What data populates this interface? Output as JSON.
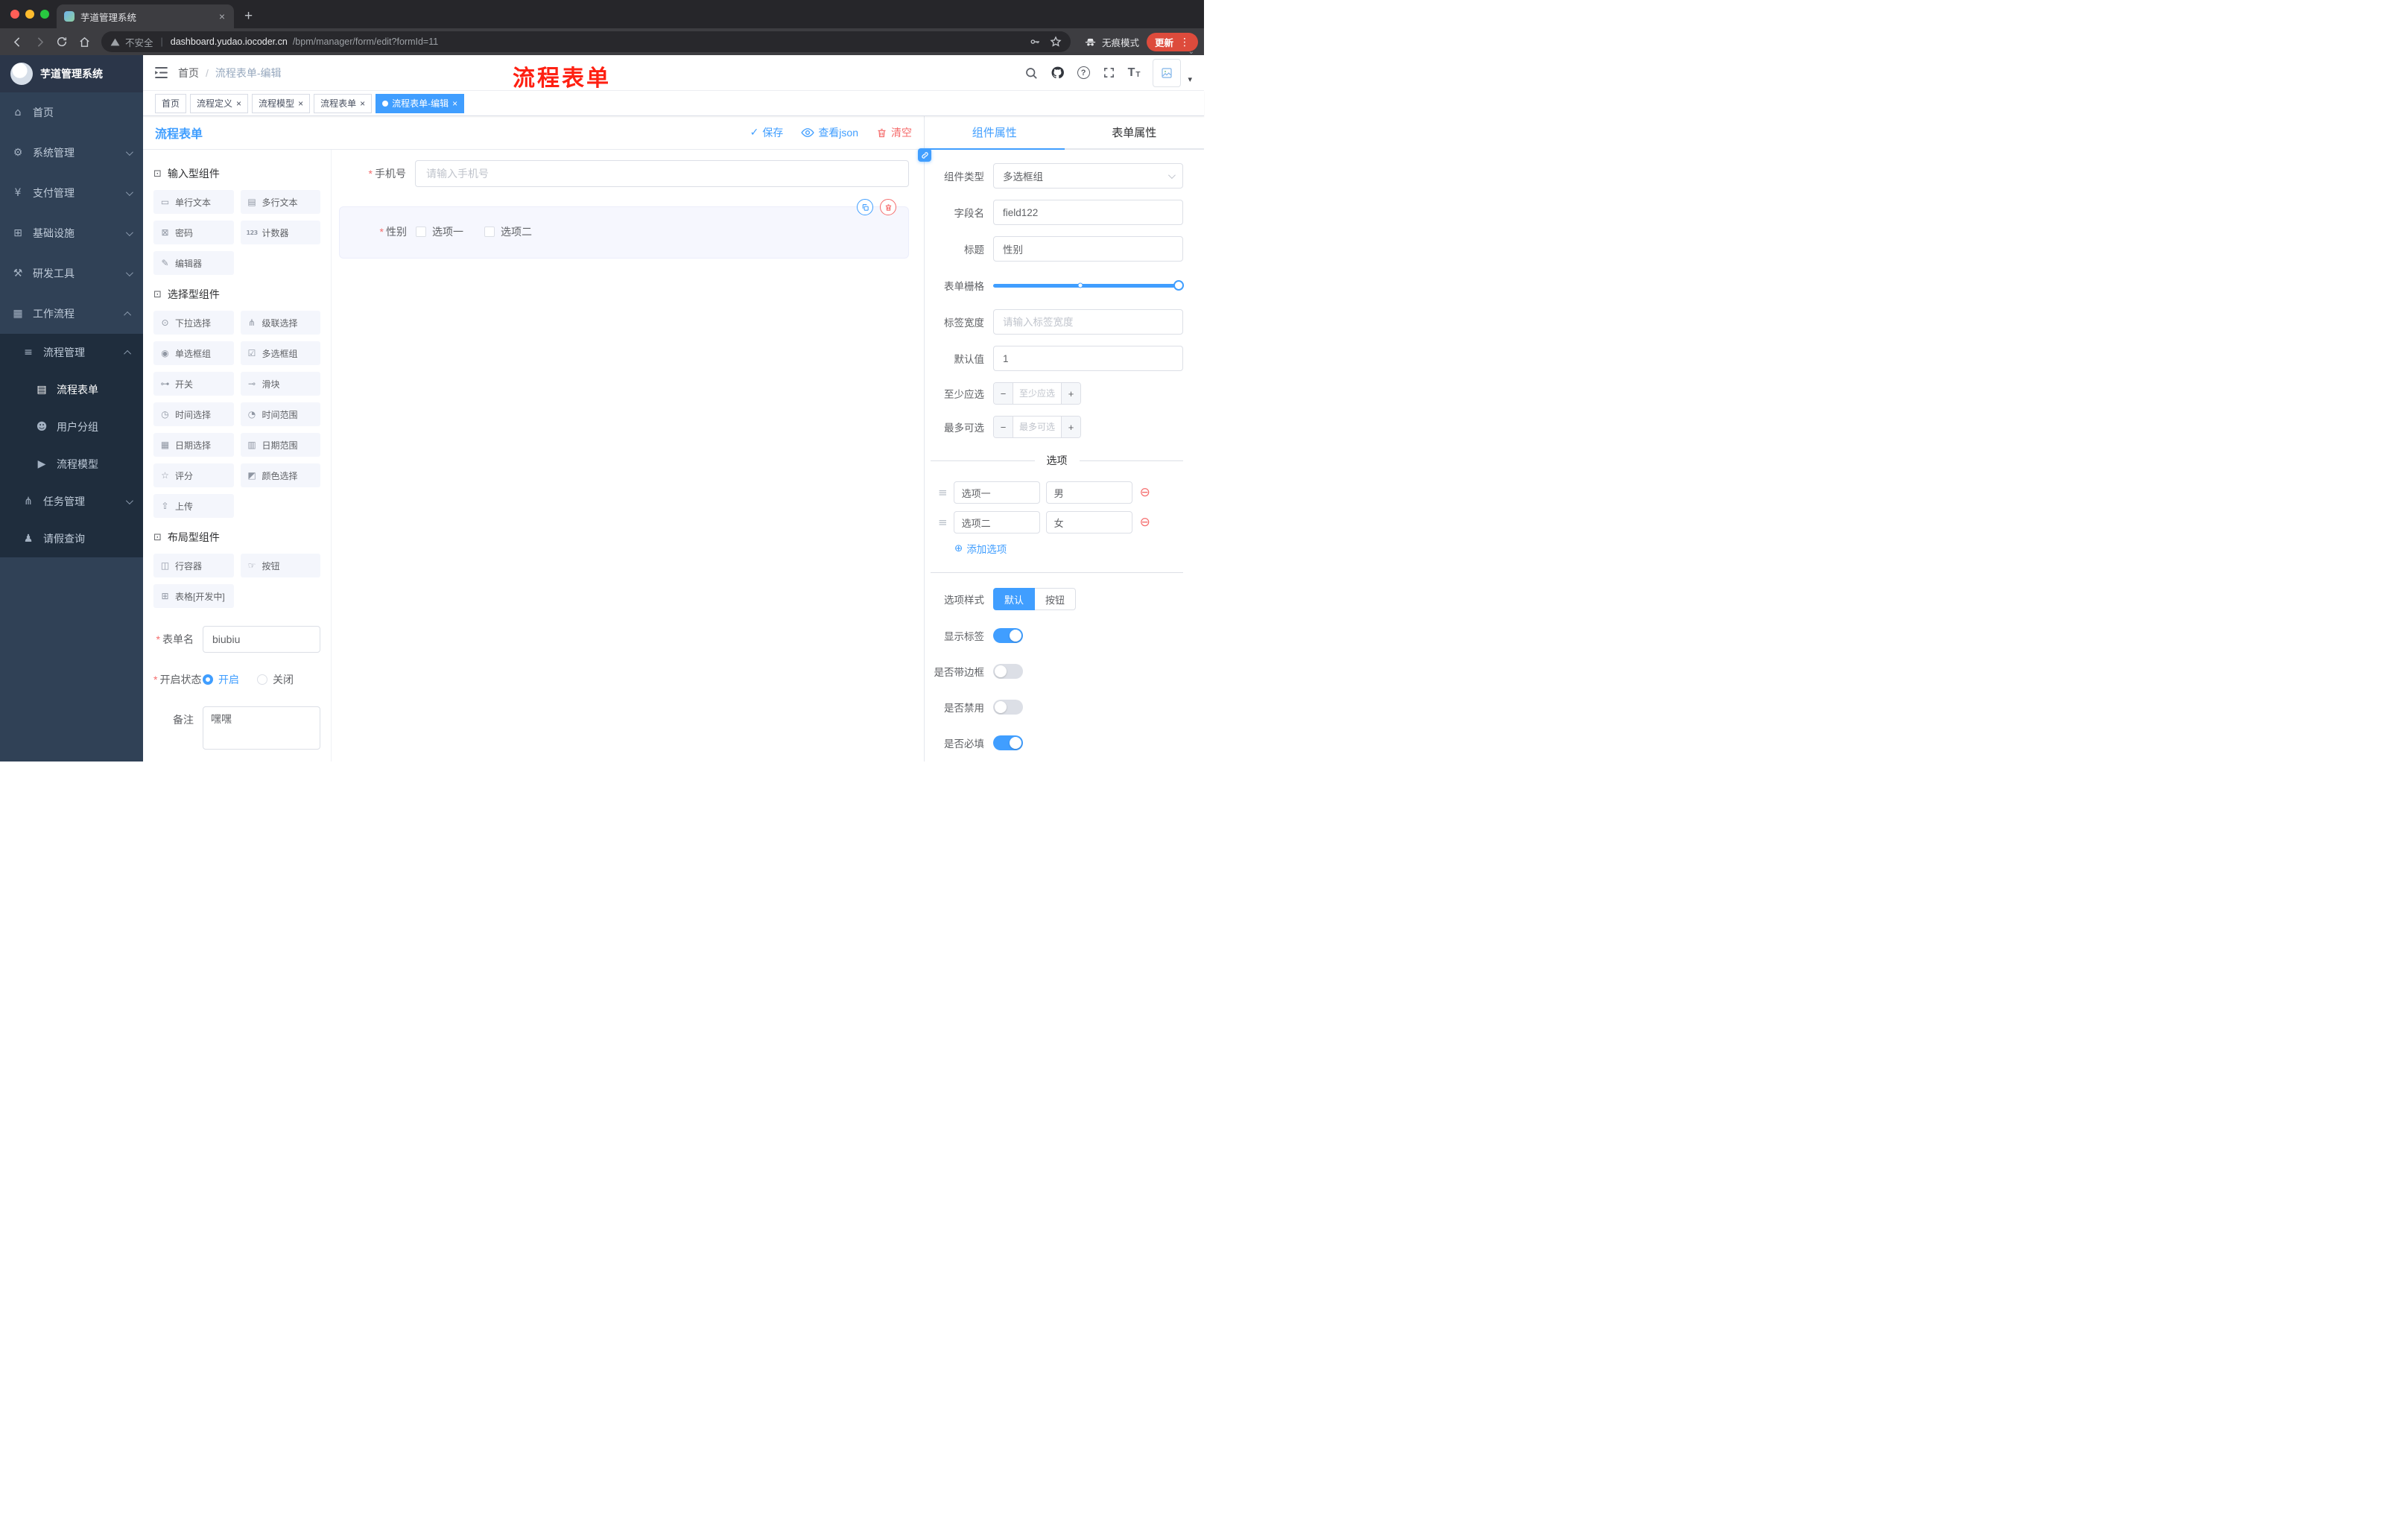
{
  "colors": {
    "accent": "#409eff",
    "danger": "#f56c6c",
    "annotation_red": "#fe2012",
    "sidebar_bg": "#304156",
    "sidebar_sub_bg": "#1f2d3d",
    "update_pill": "#dd4b3c"
  },
  "ui": {
    "close": "×",
    "check": "✓",
    "kebab": "⋮",
    "caret_down": "▾",
    "chevron_small": "⌄",
    "question": "?",
    "required_mark": "*",
    "minus": "−",
    "plus": "+",
    "add_glyph": "⊕",
    "remove_glyph": "⊖",
    "drag_glyph": "≡",
    "section_glyph": "⊡",
    "url_sep": "|",
    "tt": "T",
    "new_tab": "+"
  },
  "browser": {
    "tab_title": "芋道管理系统",
    "security_label": "不安全",
    "url_domain": "dashboard.yudao.iocoder.cn",
    "url_path": "/bpm/manager/form/edit?formId=11",
    "incognito_label": "无痕模式",
    "update_label": "更新"
  },
  "annotation": {
    "text": "流程表单"
  },
  "sidebar": {
    "logo_title": "芋道管理系统",
    "items": [
      {
        "label": "首页",
        "glyph": "⌂"
      },
      {
        "label": "系统管理",
        "glyph": "⚙"
      },
      {
        "label": "支付管理",
        "glyph": "¥"
      },
      {
        "label": "基础设施",
        "glyph": "⊞"
      },
      {
        "label": "研发工具",
        "glyph": "⚒"
      },
      {
        "label": "工作流程",
        "glyph": "▦"
      },
      {
        "label": "流程管理",
        "glyph": "≡"
      },
      {
        "label": "流程表单",
        "glyph": "▤"
      },
      {
        "label": "用户分组",
        "glyph": "☻"
      },
      {
        "label": "流程模型",
        "glyph": "▶"
      },
      {
        "label": "任务管理",
        "glyph": "⋔"
      },
      {
        "label": "请假查询",
        "glyph": "♟"
      }
    ]
  },
  "breadcrumb": {
    "home": "首页",
    "sep": "/",
    "current": "流程表单-编辑"
  },
  "tags": [
    {
      "label": "首页"
    },
    {
      "label": "流程定义"
    },
    {
      "label": "流程模型"
    },
    {
      "label": "流程表单"
    },
    {
      "label": "流程表单-编辑"
    }
  ],
  "designer": {
    "title": "流程表单",
    "actions": {
      "save": "保存",
      "view_json": "查看json",
      "clear": "清空"
    },
    "palette": {
      "sections": [
        {
          "title": "输入型组件",
          "items": [
            {
              "label": "单行文本",
              "glyph": "▭"
            },
            {
              "label": "多行文本",
              "glyph": "▤"
            },
            {
              "label": "密码",
              "glyph": "⊠"
            },
            {
              "label": "计数器",
              "glyph": "123"
            },
            {
              "label": "编辑器",
              "glyph": "✎"
            }
          ]
        },
        {
          "title": "选择型组件",
          "items": [
            {
              "label": "下拉选择",
              "glyph": "⊙"
            },
            {
              "label": "级联选择",
              "glyph": "⋔"
            },
            {
              "label": "单选框组",
              "glyph": "◉"
            },
            {
              "label": "多选框组",
              "glyph": "☑"
            },
            {
              "label": "开关",
              "glyph": "⊶"
            },
            {
              "label": "滑块",
              "glyph": "⊸"
            },
            {
              "label": "时间选择",
              "glyph": "◷"
            },
            {
              "label": "时间范围",
              "glyph": "◔"
            },
            {
              "label": "日期选择",
              "glyph": "▦"
            },
            {
              "label": "日期范围",
              "glyph": "▥"
            },
            {
              "label": "评分",
              "glyph": "☆"
            },
            {
              "label": "颜色选择",
              "glyph": "◩"
            },
            {
              "label": "上传",
              "glyph": "⇧"
            }
          ]
        },
        {
          "title": "布局型组件",
          "items": [
            {
              "label": "行容器",
              "glyph": "◫"
            },
            {
              "label": "按钮",
              "glyph": "☞"
            },
            {
              "label": "表格[开发中]",
              "glyph": "⊞"
            }
          ]
        }
      ]
    },
    "form": {
      "name_label": "表单名",
      "name_value": "biubiu",
      "status_label": "开启状态",
      "status_on": "开启",
      "status_off": "关闭",
      "remark_label": "备注",
      "remark_value": "嘿嘿"
    },
    "canvas": {
      "phone_label": "手机号",
      "phone_placeholder": "请输入手机号",
      "gender_label": "性别",
      "gender_opt1": "选项一",
      "gender_opt2": "选项二"
    }
  },
  "props": {
    "tab_component": "组件属性",
    "tab_form": "表单属性",
    "rows": {
      "type_label": "组件类型",
      "type_value": "多选框组",
      "field_label": "字段名",
      "field_value": "field122",
      "title_label": "标题",
      "title_value": "性别",
      "grid_label": "表单栅格",
      "labelwidth_label": "标签宽度",
      "labelwidth_placeholder": "请输入标签宽度",
      "default_label": "默认值",
      "default_value": "1",
      "min_label": "至少应选",
      "min_placeholder": "至少应选",
      "max_label": "最多可选",
      "max_placeholder": "最多可选"
    },
    "options": {
      "divider": "选项",
      "rows": [
        {
          "label": "选项一",
          "value": "男"
        },
        {
          "label": "选项二",
          "value": "女"
        }
      ],
      "add": "添加选项"
    },
    "style": {
      "optstyle_label": "选项样式",
      "opt_default": "默认",
      "opt_button": "按钮",
      "toggle_show_label": "显示标签",
      "toggle_border": "是否带边框",
      "toggle_disabled": "是否禁用",
      "toggle_required": "是否必填"
    }
  }
}
